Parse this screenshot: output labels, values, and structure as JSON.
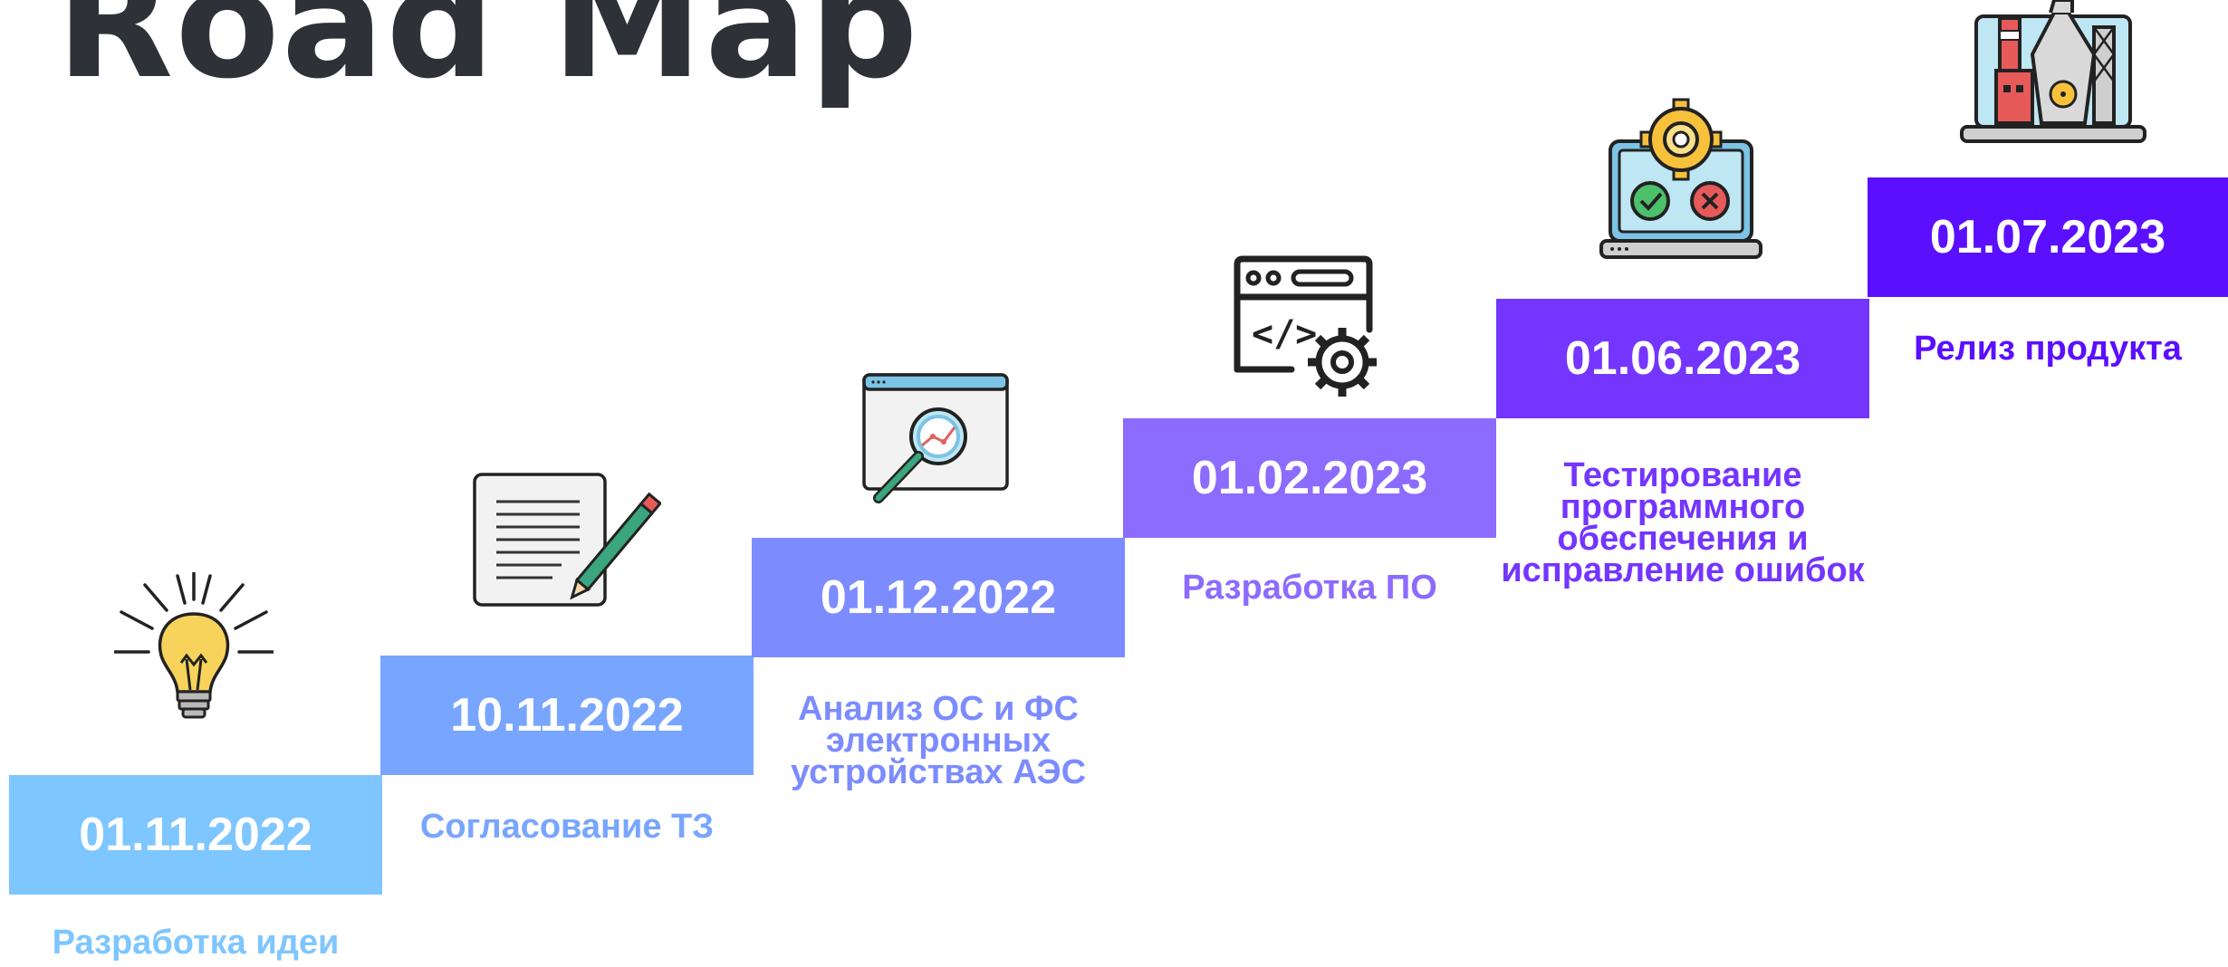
{
  "title": "Road Map",
  "milestones": [
    {
      "date": "01.11.2022",
      "label": "Разработка идеи",
      "color": "#7ec6ff",
      "icon": "lightbulb-icon"
    },
    {
      "date": "10.11.2022",
      "label": "Согласование ТЗ",
      "color": "#78a6ff",
      "icon": "document-pencil-icon"
    },
    {
      "date": "01.12.2022",
      "label": "Анализ ОС и ФС электронных устройствах АЭС",
      "color": "#7c8cff",
      "icon": "browser-magnifier-icon"
    },
    {
      "date": "01.02.2023",
      "label": "Разработка ПО",
      "color": "#8c6bff",
      "icon": "code-window-gear-icon"
    },
    {
      "date": "01.06.2023",
      "label": "Тестирование программного обеспечения и исправление ошибок",
      "color": "#7435ff",
      "icon": "laptop-gear-check-icon"
    },
    {
      "date": "01.07.2023",
      "label": "Релиз продукта",
      "color": "#5b0fff",
      "icon": "laptop-power-plant-icon"
    }
  ]
}
